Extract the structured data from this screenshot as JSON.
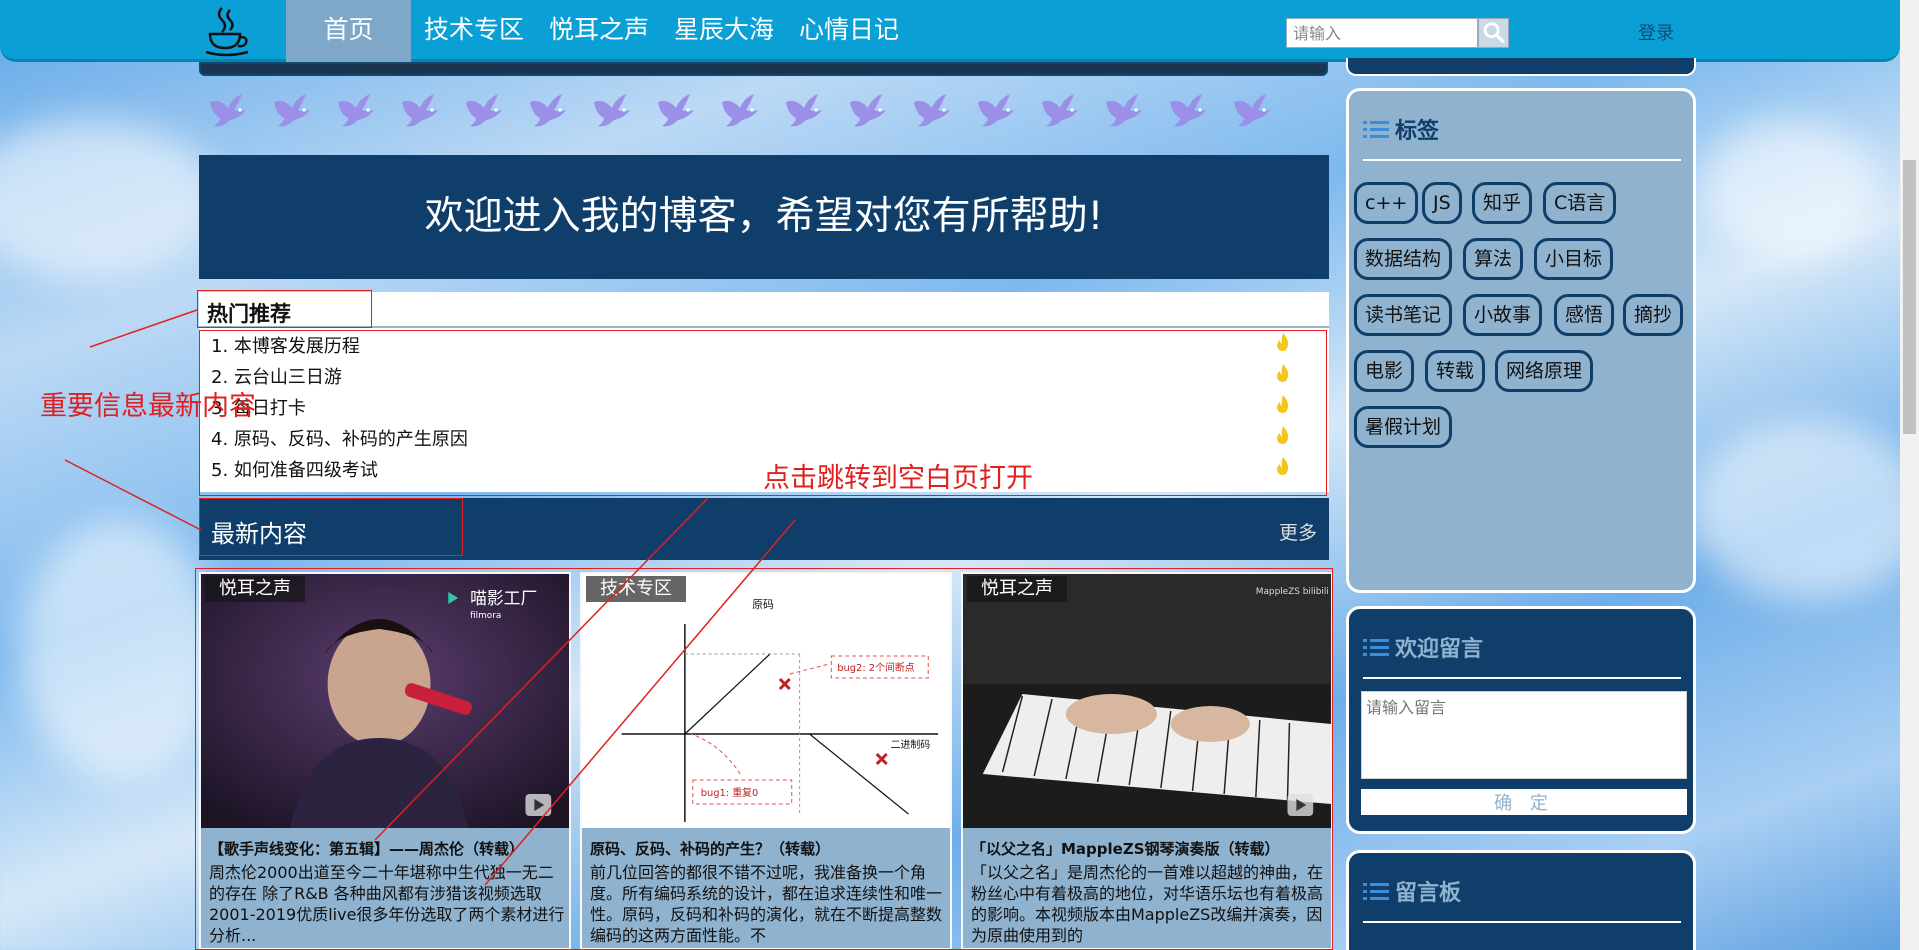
{
  "nav": {
    "items": [
      "首页",
      "技术专区",
      "悦耳之声",
      "星辰大海",
      "心情日记"
    ],
    "search_placeholder": "请输入",
    "login": "登录"
  },
  "welcome": "欢迎进入我的博客，希望对您有所帮助!",
  "hot": {
    "title": "热门推荐",
    "items": [
      "1. 本博客发展历程",
      "2. 云台山三日游",
      "3. 每日打卡",
      "4. 原码、反码、补码的产生原因",
      "5. 如何准备四级考试"
    ]
  },
  "latest": {
    "title": "最新内容",
    "more": "更多"
  },
  "cards": [
    {
      "tag": "悦耳之声",
      "title": "【歌手声线变化：第五辑】——周杰伦（转载）",
      "desc": "周杰伦2000出道至今二十年堪称中生代独一无二的存在 除了R&B 各种曲风都有涉猎该视频选取2001-2019优质live很多年份选取了两个素材进行分析..."
    },
    {
      "tag": "技术专区",
      "title": "原码、反码、补码的产生？（转载）",
      "desc": "前几位回答的都很不错不过呢，我准备换一个角度。所有编码系统的设计，都在追求连续性和唯一性。原码，反码和补码的演化，就在不断提高整数编码的这两方面性能。不"
    },
    {
      "tag": "悦耳之声",
      "title": "「以父之名」MappleZS钢琴演奏版（转载）",
      "desc": "「以父之名」是周杰伦的一首难以超越的神曲，在粉丝心中有着极高的地位，对华语乐坛也有着极高的影响。本视频版本由MappleZS改编并演奏，因为原曲使用到的"
    }
  ],
  "card_images": {
    "card1_logo": "喵影工厂",
    "card1_logo_sub": "filmora",
    "card2_heading": "原码",
    "card2_bug2": "bug2: 2个间断点",
    "card2_bug1": "bug1: 重复0",
    "card2_axis": "二进制码",
    "card3_watermark": "MappleZS bilibili"
  },
  "sidebar": {
    "tags_title": "标签",
    "tags": [
      "c++",
      "JS",
      "知乎",
      "C语言",
      "数据结构",
      "算法",
      "小目标",
      "读书笔记",
      "小故事",
      "感悟",
      "摘抄",
      "电影",
      "转载",
      "网络原理",
      "暑假计划"
    ],
    "message_title": "欢迎留言",
    "message_placeholder": "请输入留言",
    "submit": "确 定",
    "board_title": "留言板"
  },
  "annotations": {
    "left": "重要信息最新内容",
    "right": "点击跳转到空白页打开"
  },
  "colors": {
    "nav": "#0aa0d6",
    "dark_blue": "#0f3e6a",
    "panel": "#8fb2cf",
    "annotation": "#e02020"
  }
}
